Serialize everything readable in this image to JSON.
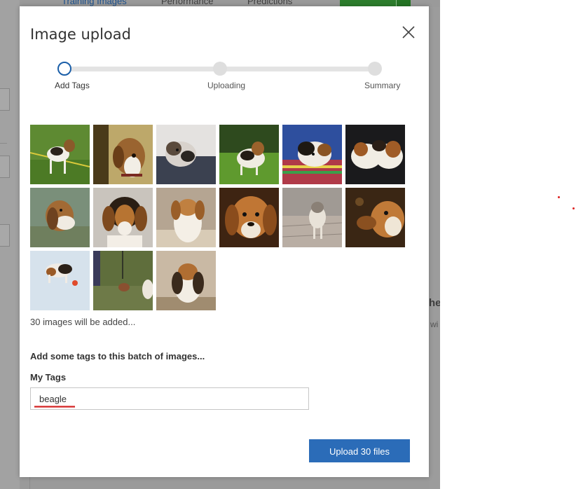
{
  "background": {
    "tabs": [
      "Training Images",
      "Performance",
      "Predictions"
    ],
    "fragment_heading": "he",
    "fragment_text": "wi"
  },
  "dialog": {
    "title": "Image upload",
    "close_icon": "close-icon",
    "steps": [
      {
        "label": "Add Tags",
        "state": "active"
      },
      {
        "label": "Uploading",
        "state": "pending"
      },
      {
        "label": "Summary",
        "state": "pending"
      }
    ],
    "thumbnails_description_count": 15,
    "images_added_text": "30 images will be added...",
    "tags_prompt": "Add some tags to this batch of images...",
    "tags_field_label": "My Tags",
    "tags_field_value": "beagle",
    "upload_button_label": "Upload 30 files"
  },
  "colors": {
    "accent": "#2b6cb8",
    "step_active_border": "#1a5ea8",
    "spellcheck_underline": "#d42424",
    "overlay": "#9a9a9a"
  }
}
